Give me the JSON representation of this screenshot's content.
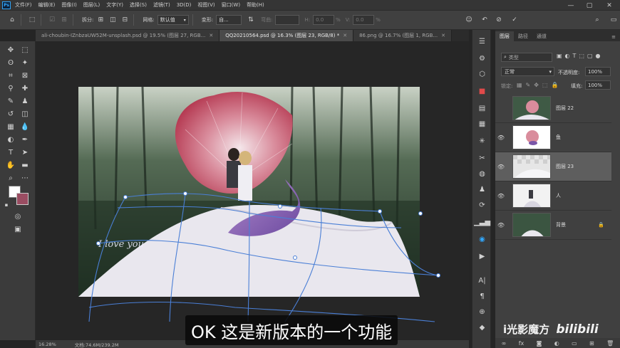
{
  "app": {
    "logo": "Ps"
  },
  "menu": [
    "文件(F)",
    "编辑(E)",
    "图像(I)",
    "图层(L)",
    "文字(Y)",
    "选择(S)",
    "滤镜(T)",
    "3D(D)",
    "视图(V)",
    "窗口(W)",
    "帮助(H)"
  ],
  "options": {
    "split_label": "拆分:",
    "grid_label": "网格:",
    "grid_value": "默认值",
    "warp_label": "变形:",
    "warp_value": "自...",
    "h_label": "H:",
    "h_value": "0.0",
    "v_label": "V:",
    "v_value": "0.0",
    "percent": "%"
  },
  "tabs": [
    {
      "label": "ali-choubin-IZnbzaUW52M-unsplash.psd @ 19.5% (图层 27, RGB...",
      "active": false
    },
    {
      "label": "QQ20210564.psd @ 16.3% (图层 23, RGB/8) *",
      "active": true
    },
    {
      "label": "86.png @ 16.7% (图层 1, RGB...",
      "active": false
    }
  ],
  "canvas": {
    "watermark": "I love you"
  },
  "status": {
    "zoom": "16.28%",
    "doc": "文档:74.6M/239.2M"
  },
  "subtitle": "OK 这是新版本的一个功能",
  "panel": {
    "tabs": [
      "图层",
      "路径",
      "通道"
    ],
    "search_placeholder": "类型",
    "blend_mode": "正常",
    "opacity_label": "不透明度:",
    "opacity_value": "100%",
    "lock_label": "锁定:",
    "fill_label": "填充:",
    "fill_value": "100%",
    "layers": [
      {
        "name": "图层 22",
        "visible": false,
        "selected": false,
        "locked": false
      },
      {
        "name": "鱼",
        "visible": true,
        "selected": false,
        "locked": false
      },
      {
        "name": "图层 23",
        "visible": true,
        "selected": true,
        "locked": false
      },
      {
        "name": "人",
        "visible": true,
        "selected": false,
        "locked": false
      },
      {
        "name": "背景",
        "visible": true,
        "selected": false,
        "locked": true
      }
    ]
  },
  "brand": {
    "left": "i光影魔方",
    "right": "bilibili"
  },
  "colors": {
    "accent": "#31a8ff",
    "warp_grid": "#4a7fd6"
  }
}
